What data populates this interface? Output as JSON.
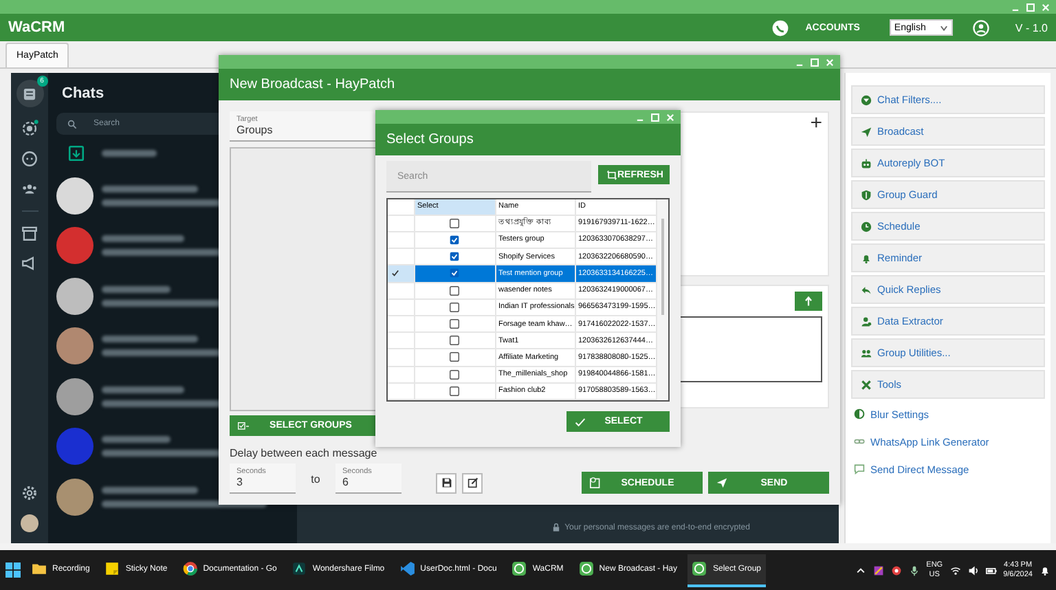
{
  "app": {
    "title": "WaCRM",
    "accounts": "ACCOUNTS",
    "language": "English",
    "version": "V - 1.0"
  },
  "tabs": [
    {
      "label": "HayPatch",
      "selected": true
    }
  ],
  "whatsapp": {
    "unread_badge": "6",
    "title": "Chats",
    "search_placeholder": "Search",
    "encryption_note": "Your personal messages are end-to-end encrypted",
    "chat_rows": [
      {
        "color": "#d9d9d9"
      },
      {
        "color": "#d32f2f"
      },
      {
        "color": "#bdbdbd"
      },
      {
        "color": "#b08870"
      },
      {
        "color": "#9e9e9e"
      },
      {
        "color": "#1a2fd0"
      },
      {
        "color": "#a89070"
      }
    ]
  },
  "broadcast": {
    "title": "New Broadcast - HayPatch",
    "target_label": "Target",
    "target_value": "Groups",
    "add": "+",
    "select_groups": "SELECT GROUPS",
    "delay_label": "Delay between each message",
    "delay_from": {
      "label": "Seconds",
      "value": "3"
    },
    "to": "to",
    "delay_to": {
      "label": "Seconds",
      "value": "6"
    },
    "schedule": "SCHEDULE",
    "send": "SEND"
  },
  "select_groups": {
    "title": "Select Groups",
    "search_placeholder": "Search",
    "refresh": "REFRESH",
    "columns": [
      "Select",
      "Name",
      "ID"
    ],
    "rows": [
      {
        "name": "তথ্যপ্রযুক্তি কাব্য",
        "id": "919167939711-1622…",
        "checked": false,
        "selected": false
      },
      {
        "name": "Testers group",
        "id": "1203633070638297…",
        "checked": true,
        "selected": false
      },
      {
        "name": "Shopify Services",
        "id": "1203632206680590…",
        "checked": true,
        "selected": false
      },
      {
        "name": "Test mention group",
        "id": "1203633134166225…",
        "checked": true,
        "selected": true
      },
      {
        "name": "wasender notes",
        "id": "1203632419000067…",
        "checked": false,
        "selected": false
      },
      {
        "name": "Indian IT professionals",
        "id": "966563473199-1595…",
        "checked": false,
        "selected": false
      },
      {
        "name": "Forsage team khaw…",
        "id": "917416022022-1537…",
        "checked": false,
        "selected": false
      },
      {
        "name": "Twat1",
        "id": "1203632612637444…",
        "checked": false,
        "selected": false
      },
      {
        "name": "Affiliate Marketing",
        "id": "917838808080-1525…",
        "checked": false,
        "selected": false
      },
      {
        "name": "The_millenials_shop",
        "id": "919840044866-1581…",
        "checked": false,
        "selected": false
      },
      {
        "name": "Fashion club2",
        "id": "917058803589-1563…",
        "checked": false,
        "selected": false
      }
    ],
    "select": "SELECT"
  },
  "sidebar": {
    "items": [
      {
        "label": "Chat Filters....",
        "kind": "card"
      },
      {
        "label": "Broadcast",
        "kind": "card"
      },
      {
        "label": "Autoreply BOT",
        "kind": "card"
      },
      {
        "label": "Group Guard",
        "kind": "card"
      },
      {
        "label": "Schedule",
        "kind": "card"
      },
      {
        "label": "Reminder",
        "kind": "card"
      },
      {
        "label": "Quick Replies",
        "kind": "card"
      },
      {
        "label": "Data Extractor",
        "kind": "card"
      },
      {
        "label": "Group Utilities...",
        "kind": "card"
      },
      {
        "label": "Tools",
        "kind": "card"
      },
      {
        "label": "Blur Settings",
        "kind": "link"
      },
      {
        "label": "WhatsApp Link Generator",
        "kind": "link"
      },
      {
        "label": "Send Direct Message",
        "kind": "link"
      }
    ]
  },
  "taskbar": {
    "items": [
      {
        "label": "Recording",
        "active": false
      },
      {
        "label": "Sticky Note",
        "active": false
      },
      {
        "label": "Documentation - Go",
        "active": false
      },
      {
        "label": "Wondershare Filmo",
        "active": false
      },
      {
        "label": "UserDoc.html - Docu",
        "active": false
      },
      {
        "label": "WaCRM",
        "active": false
      },
      {
        "label": "New Broadcast - Hay",
        "active": false
      },
      {
        "label": "Select Group",
        "active": true
      }
    ],
    "language": "ENG",
    "region": "US",
    "time": "4:43 PM",
    "date": "9/6/2024"
  }
}
